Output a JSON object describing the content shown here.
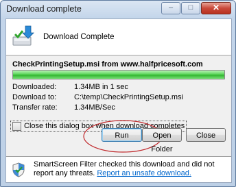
{
  "window": {
    "title": "Download complete",
    "minimize_glyph": "–",
    "maximize_glyph": "□",
    "close_glyph": "✕"
  },
  "header": {
    "text": "Download Complete"
  },
  "download": {
    "file_line": "CheckPrintingSetup.msi from www.halfpricesoft.com",
    "progress": 1.0,
    "downloaded_label": "Downloaded:",
    "downloaded_value": "1.34MB in 1 sec",
    "download_to_label": "Download to:",
    "download_to_value": "C:\\temp\\CheckPrintingSetup.msi",
    "transfer_rate_label": "Transfer rate:",
    "transfer_rate_value": "1.34MB/Sec"
  },
  "options": {
    "close_when_complete": "Close this dialog box when download completes",
    "close_when_complete_checked": false
  },
  "buttons": {
    "run": "Run",
    "open_folder": "Open Folder",
    "close": "Close"
  },
  "smartscreen": {
    "text": "SmartScreen Filter checked this download and did not report any threats.",
    "link": "Report an unsafe download."
  },
  "colors": {
    "progress_fill": "#2fb52e",
    "annotation_ellipse": "#c0282b",
    "link": "#0066cc"
  }
}
